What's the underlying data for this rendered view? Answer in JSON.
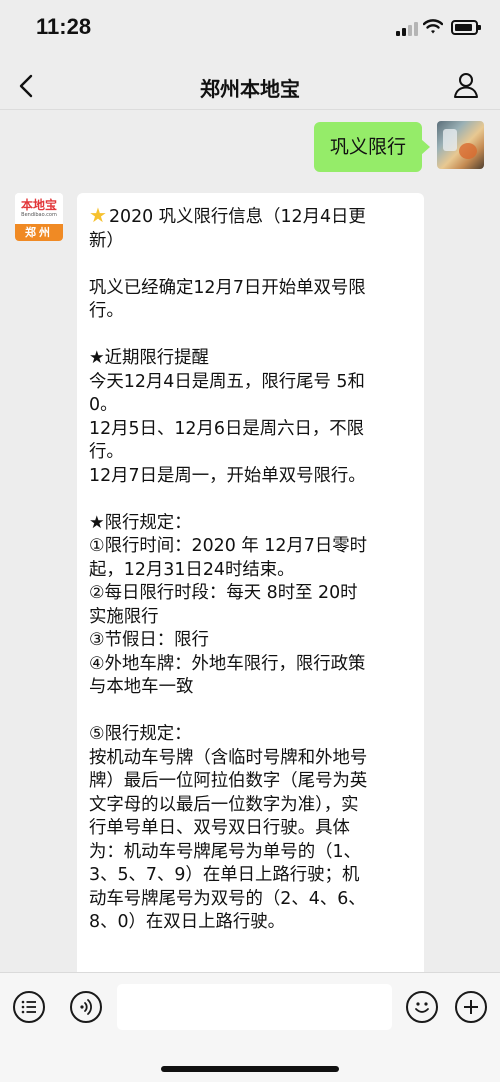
{
  "status_bar": {
    "time": "11:28"
  },
  "nav": {
    "title": "郑州本地宝"
  },
  "outgoing_message": {
    "text": "巩义限行"
  },
  "brand_avatar": {
    "logo_text": "本地宝",
    "url_text": "Bendibao.com",
    "city": "郑州"
  },
  "incoming_message": {
    "lines": [
      "2020 巩义限行信息（12月4日更",
      "新）",
      "",
      "巩义已经确定12月7日开始单双号限",
      "行。",
      "",
      "★近期限行提醒",
      "今天12月4日是周五，限行尾号 5和",
      "0。",
      "12月5日、12月6日是周六日，不限",
      "行。",
      "12月7日是周一，开始单双号限行。",
      "",
      "★限行规定：",
      "①限行时间：2020 年 12月7日零时",
      "起，12月31日24时结束。",
      "②每日限行时段：每天 8时至 20时",
      "实施限行",
      "③节假日：限行",
      "④外地车牌：外地车限行，限行政策",
      "与本地车一致",
      "",
      "⑤限行规定：",
      "按机动车号牌（含临时号牌和外地号",
      "牌）最后一位阿拉伯数字（尾号为英",
      "文字母的以最后一位数字为准），实",
      "行单号单日、双号双日行驶。具体",
      "为：机动车号牌尾号为单号的（1、",
      "3、5、7、9）在单日上路行驶；机",
      "动车号牌尾号为双号的（2、4、6、",
      "8、0）在双日上路行驶。"
    ]
  },
  "input_bar": {
    "placeholder": ""
  },
  "colors": {
    "outgoing_bubble": "#95ec69",
    "background": "#ededed",
    "brand_orange": "#f08a24",
    "brand_red": "#e2373a"
  },
  "icons": [
    "signal-icon",
    "wifi-icon",
    "battery-icon",
    "back-arrow-icon",
    "user-icon",
    "star-emoji-icon",
    "menu-icon",
    "voice-icon",
    "emoji-icon",
    "plus-icon"
  ]
}
